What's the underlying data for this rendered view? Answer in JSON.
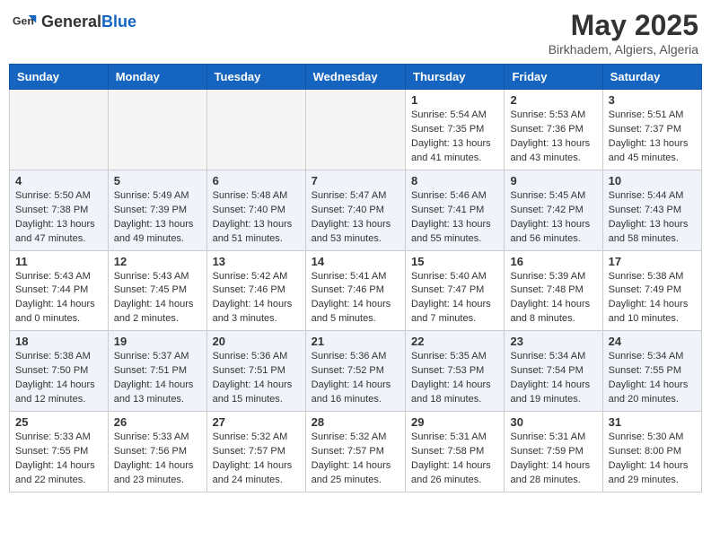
{
  "header": {
    "logo_general": "General",
    "logo_blue": "Blue",
    "month_year": "May 2025",
    "location": "Birkhadem, Algiers, Algeria"
  },
  "weekdays": [
    "Sunday",
    "Monday",
    "Tuesday",
    "Wednesday",
    "Thursday",
    "Friday",
    "Saturday"
  ],
  "weeks": [
    [
      {
        "day": "",
        "empty": true
      },
      {
        "day": "",
        "empty": true
      },
      {
        "day": "",
        "empty": true
      },
      {
        "day": "",
        "empty": true
      },
      {
        "day": "1",
        "sunrise": "5:54 AM",
        "sunset": "7:35 PM",
        "daylight": "13 hours and 41 minutes."
      },
      {
        "day": "2",
        "sunrise": "5:53 AM",
        "sunset": "7:36 PM",
        "daylight": "13 hours and 43 minutes."
      },
      {
        "day": "3",
        "sunrise": "5:51 AM",
        "sunset": "7:37 PM",
        "daylight": "13 hours and 45 minutes."
      }
    ],
    [
      {
        "day": "4",
        "sunrise": "5:50 AM",
        "sunset": "7:38 PM",
        "daylight": "13 hours and 47 minutes."
      },
      {
        "day": "5",
        "sunrise": "5:49 AM",
        "sunset": "7:39 PM",
        "daylight": "13 hours and 49 minutes."
      },
      {
        "day": "6",
        "sunrise": "5:48 AM",
        "sunset": "7:40 PM",
        "daylight": "13 hours and 51 minutes."
      },
      {
        "day": "7",
        "sunrise": "5:47 AM",
        "sunset": "7:40 PM",
        "daylight": "13 hours and 53 minutes."
      },
      {
        "day": "8",
        "sunrise": "5:46 AM",
        "sunset": "7:41 PM",
        "daylight": "13 hours and 55 minutes."
      },
      {
        "day": "9",
        "sunrise": "5:45 AM",
        "sunset": "7:42 PM",
        "daylight": "13 hours and 56 minutes."
      },
      {
        "day": "10",
        "sunrise": "5:44 AM",
        "sunset": "7:43 PM",
        "daylight": "13 hours and 58 minutes."
      }
    ],
    [
      {
        "day": "11",
        "sunrise": "5:43 AM",
        "sunset": "7:44 PM",
        "daylight": "14 hours and 0 minutes."
      },
      {
        "day": "12",
        "sunrise": "5:43 AM",
        "sunset": "7:45 PM",
        "daylight": "14 hours and 2 minutes."
      },
      {
        "day": "13",
        "sunrise": "5:42 AM",
        "sunset": "7:46 PM",
        "daylight": "14 hours and 3 minutes."
      },
      {
        "day": "14",
        "sunrise": "5:41 AM",
        "sunset": "7:46 PM",
        "daylight": "14 hours and 5 minutes."
      },
      {
        "day": "15",
        "sunrise": "5:40 AM",
        "sunset": "7:47 PM",
        "daylight": "14 hours and 7 minutes."
      },
      {
        "day": "16",
        "sunrise": "5:39 AM",
        "sunset": "7:48 PM",
        "daylight": "14 hours and 8 minutes."
      },
      {
        "day": "17",
        "sunrise": "5:38 AM",
        "sunset": "7:49 PM",
        "daylight": "14 hours and 10 minutes."
      }
    ],
    [
      {
        "day": "18",
        "sunrise": "5:38 AM",
        "sunset": "7:50 PM",
        "daylight": "14 hours and 12 minutes."
      },
      {
        "day": "19",
        "sunrise": "5:37 AM",
        "sunset": "7:51 PM",
        "daylight": "14 hours and 13 minutes."
      },
      {
        "day": "20",
        "sunrise": "5:36 AM",
        "sunset": "7:51 PM",
        "daylight": "14 hours and 15 minutes."
      },
      {
        "day": "21",
        "sunrise": "5:36 AM",
        "sunset": "7:52 PM",
        "daylight": "14 hours and 16 minutes."
      },
      {
        "day": "22",
        "sunrise": "5:35 AM",
        "sunset": "7:53 PM",
        "daylight": "14 hours and 18 minutes."
      },
      {
        "day": "23",
        "sunrise": "5:34 AM",
        "sunset": "7:54 PM",
        "daylight": "14 hours and 19 minutes."
      },
      {
        "day": "24",
        "sunrise": "5:34 AM",
        "sunset": "7:55 PM",
        "daylight": "14 hours and 20 minutes."
      }
    ],
    [
      {
        "day": "25",
        "sunrise": "5:33 AM",
        "sunset": "7:55 PM",
        "daylight": "14 hours and 22 minutes."
      },
      {
        "day": "26",
        "sunrise": "5:33 AM",
        "sunset": "7:56 PM",
        "daylight": "14 hours and 23 minutes."
      },
      {
        "day": "27",
        "sunrise": "5:32 AM",
        "sunset": "7:57 PM",
        "daylight": "14 hours and 24 minutes."
      },
      {
        "day": "28",
        "sunrise": "5:32 AM",
        "sunset": "7:57 PM",
        "daylight": "14 hours and 25 minutes."
      },
      {
        "day": "29",
        "sunrise": "5:31 AM",
        "sunset": "7:58 PM",
        "daylight": "14 hours and 26 minutes."
      },
      {
        "day": "30",
        "sunrise": "5:31 AM",
        "sunset": "7:59 PM",
        "daylight": "14 hours and 28 minutes."
      },
      {
        "day": "31",
        "sunrise": "5:30 AM",
        "sunset": "8:00 PM",
        "daylight": "14 hours and 29 minutes."
      }
    ]
  ]
}
